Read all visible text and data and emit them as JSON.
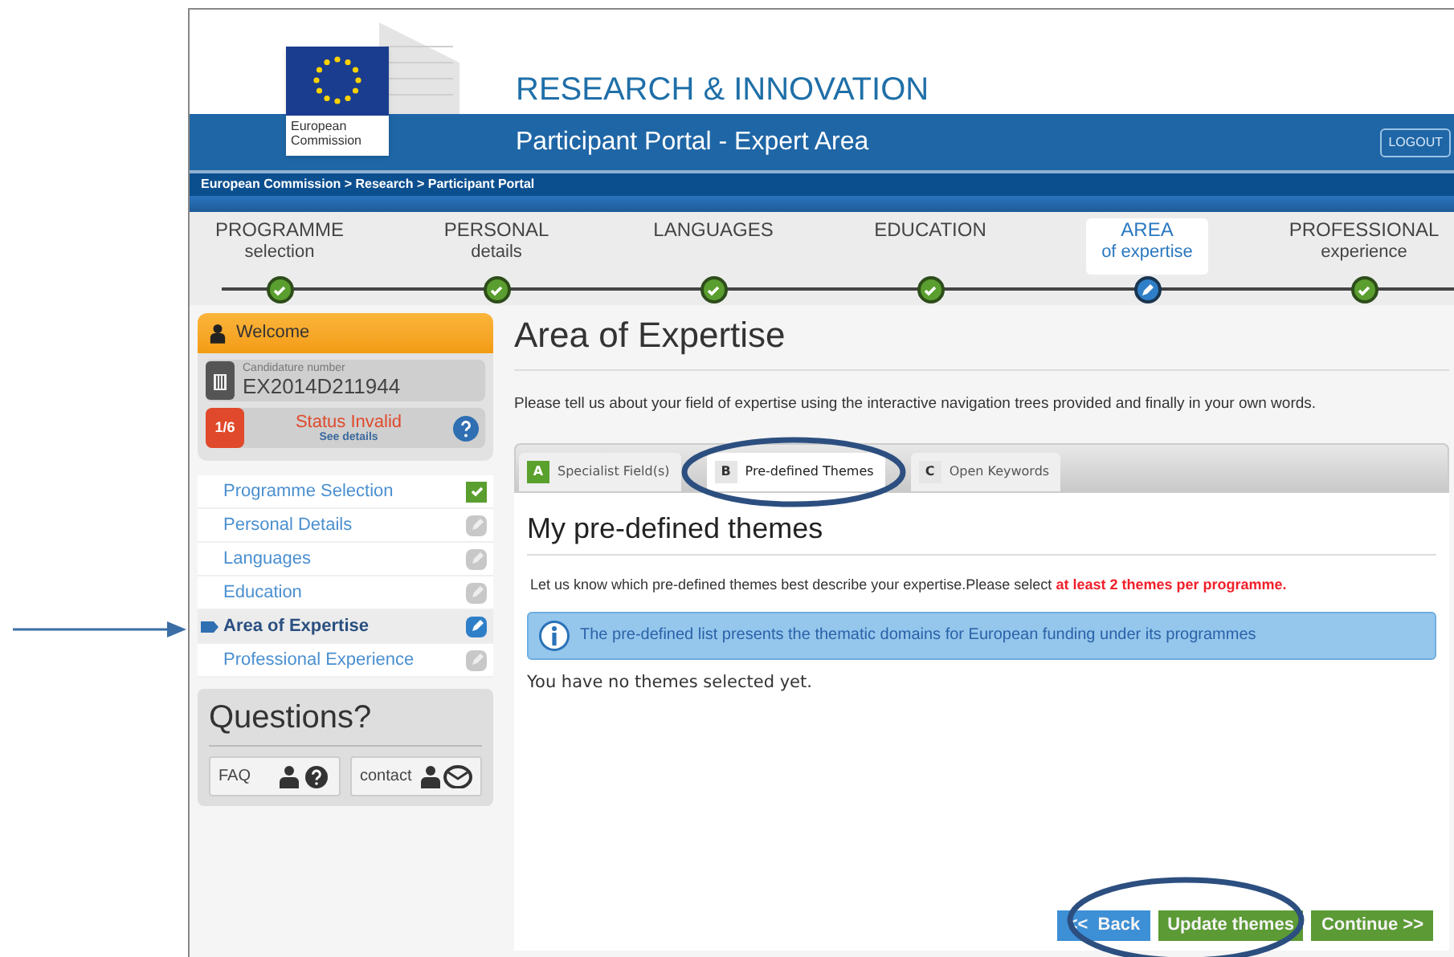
{
  "header": {
    "logo_text": "European Commission",
    "title": "RESEARCH & INNOVATION",
    "subtitle": "Participant Portal - Expert Area",
    "logout": "LOGOUT"
  },
  "breadcrumb": "European Commission > Research > Participant Portal",
  "steps": [
    {
      "title": "PROGRAMME",
      "subtitle": "selection",
      "kind": "done",
      "selected": false
    },
    {
      "title": "PERSONAL",
      "subtitle": "details",
      "kind": "done",
      "selected": false
    },
    {
      "title": "LANGUAGES",
      "kind": "done",
      "selected": false
    },
    {
      "title": "EDUCATION",
      "kind": "done",
      "selected": false
    },
    {
      "title": "AREA",
      "subtitle": "of expertise",
      "kind": "current",
      "selected": true
    },
    {
      "title": "PROFESSIONAL",
      "subtitle": "experience",
      "kind": "done",
      "selected": false
    }
  ],
  "sidebar": {
    "welcome": "Welcome",
    "candidature_label": "Candidature number",
    "candidature_number": "EX2014D211944",
    "progress": "1/6",
    "status": "Status Invalid",
    "status_link": "See details",
    "items": [
      {
        "label": "Programme Selection",
        "kind": "done",
        "selected": false
      },
      {
        "label": "Personal Details",
        "kind": "pending",
        "selected": false
      },
      {
        "label": "Languages",
        "kind": "pending",
        "selected": false
      },
      {
        "label": "Education",
        "kind": "pending",
        "selected": false
      },
      {
        "label": "Area of Expertise",
        "kind": "current",
        "selected": true
      },
      {
        "label": "Professional Experience",
        "kind": "pending",
        "selected": false
      }
    ],
    "questions": {
      "title": "Questions?",
      "buttons": [
        {
          "label": "FAQ",
          "kind": "faq"
        },
        {
          "label": "contact",
          "kind": "contact"
        }
      ]
    }
  },
  "main": {
    "title": "Area of Expertise",
    "intro": "Please tell us about your field of expertise using the interactive navigation trees provided and finally in your own words.",
    "tabs": [
      {
        "letter": "A",
        "label": "Specialist Field(s)",
        "selected": false,
        "color": "#5aa02c"
      },
      {
        "letter": "B",
        "label": "Pre-defined Themes",
        "selected": true,
        "color": "#e6e6e6"
      },
      {
        "letter": "C",
        "label": "Open Keywords",
        "selected": false,
        "color": "#e6e6e6"
      }
    ],
    "section_title": "My pre-defined themes",
    "note": "Let us know which pre-defined themes best describe your expertise.Please select",
    "note_highlight": "at least 2 themes per programme.",
    "info": "The pre-defined list presents the thematic domains for European funding under its programmes",
    "empty": "You have no themes selected yet.",
    "buttons": [
      {
        "label": "<<  Back",
        "kind": "back"
      },
      {
        "label": "Update themes",
        "kind": "primary"
      },
      {
        "label": "Continue >>",
        "kind": "primary"
      }
    ]
  },
  "annotations": {
    "tabs_circled": true,
    "buttons_circled": true,
    "arrow": true
  }
}
